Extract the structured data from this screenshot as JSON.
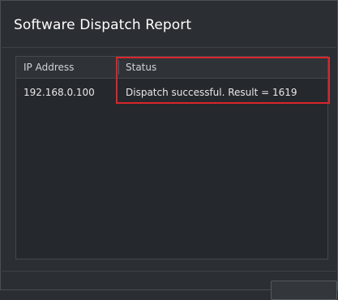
{
  "dialog": {
    "title": "Software Dispatch Report"
  },
  "table": {
    "columns": [
      "IP Address",
      "Status"
    ],
    "rows": [
      {
        "ip": "192.168.0.100",
        "status": "Dispatch successful. Result = 1619"
      }
    ]
  },
  "colors": {
    "background": "#2b2e33",
    "highlight_border": "#d9262a",
    "text": "#e8e8e8"
  }
}
